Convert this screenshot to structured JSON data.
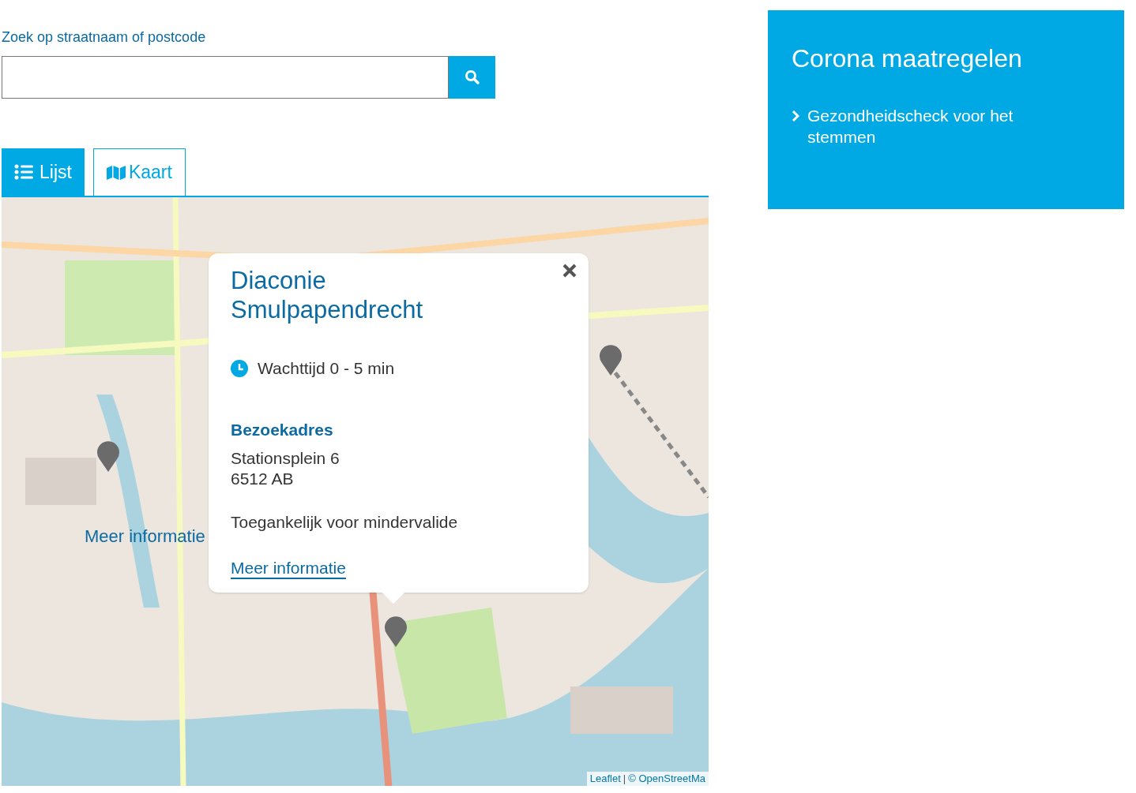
{
  "search": {
    "label": "Zoek op straatnaam of postcode"
  },
  "tabs": [
    {
      "label": "Lijst",
      "kind": "list",
      "selected": false
    },
    {
      "label": "Kaart",
      "kind": "map",
      "selected": true
    }
  ],
  "map": {
    "overlay_link": "Meer informatie",
    "popup": {
      "title": "Diaconie Smulpapendrecht",
      "wait": "Wachttijd 0 - 5 min",
      "address_heading": "Bezoekadres",
      "address_lines": [
        "Stationsplein 6",
        "6512 AB"
      ],
      "accessibility": "Toegankelijk voor mindervalide",
      "link": "Meer informatie"
    },
    "attribution": {
      "library": "Leaflet",
      "separator": "|",
      "credit": "© OpenStreetMa"
    }
  },
  "sidebar": {
    "title": "Corona maatregelen",
    "links": [
      "Gezondheidscheck voor het stemmen"
    ]
  }
}
